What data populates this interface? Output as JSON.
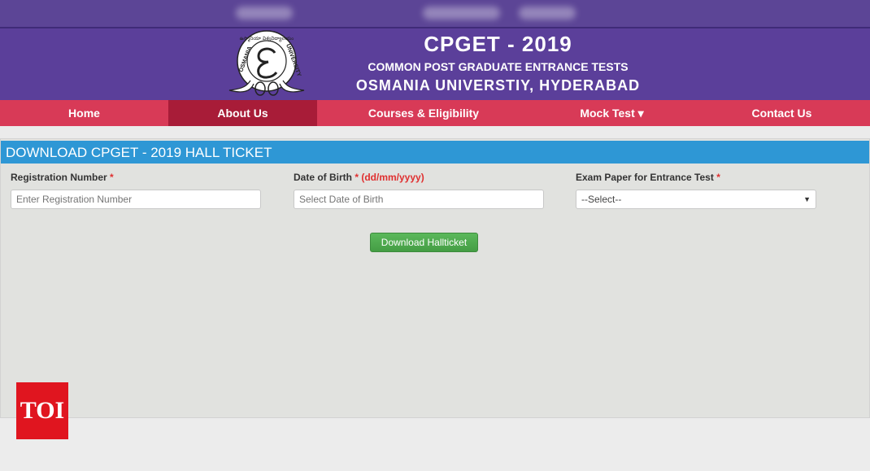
{
  "header": {
    "title": "CPGET - 2019",
    "subtitle": "COMMON POST GRADUATE ENTRANCE TESTS",
    "university": "OSMANIA UNIVERSTIY, HYDERABAD",
    "logo_ring_top": "ఉస్మానియా విశ్వవిద్యాలయం",
    "logo_ring_left": "OSMANIA",
    "logo_ring_right": "UNIVERSITY"
  },
  "nav": {
    "items": [
      {
        "label": "Home"
      },
      {
        "label": "About Us"
      },
      {
        "label": "Courses & Eligibility"
      },
      {
        "label": "Mock Test"
      },
      {
        "label": "Contact Us"
      }
    ],
    "dropdown_caret": "▾"
  },
  "panel": {
    "heading": "DOWNLOAD CPGET - 2019 HALL TICKET",
    "fields": {
      "registration": {
        "label": "Registration Number",
        "required_mark": "*",
        "placeholder": "Enter Registration Number"
      },
      "dob": {
        "label": "Date of Birth",
        "required_mark": "* (dd/mm/yyyy)",
        "placeholder": "Select Date of Birth"
      },
      "exam_paper": {
        "label": "Exam Paper for Entrance Test",
        "required_mark": "*",
        "selected": "--Select--",
        "arrow": "▼"
      }
    },
    "button": "Download Hallticket"
  },
  "watermark": "TOI",
  "colors": {
    "header_bg": "#5b3f9a",
    "nav_bg": "#d83a57",
    "nav_active": "#a81c38",
    "panel_head": "#2e97d5",
    "button": "#4cae4c"
  }
}
